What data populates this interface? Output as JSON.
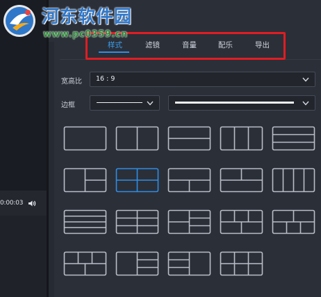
{
  "player": {
    "time": "0:00:03",
    "volume_icon": "speaker-icon"
  },
  "tabs": [
    {
      "label": "样式",
      "active": true
    },
    {
      "label": "滤镜",
      "active": false
    },
    {
      "label": "音量",
      "active": false
    },
    {
      "label": "配乐",
      "active": false
    },
    {
      "label": "导出",
      "active": false
    }
  ],
  "aspect": {
    "label": "宽高比",
    "value": "16 : 9"
  },
  "border": {
    "label": "边框"
  },
  "layouts": [
    {
      "name": "single",
      "selected": false
    },
    {
      "name": "split-2-vertical",
      "selected": false
    },
    {
      "name": "split-2-horizontal",
      "selected": false
    },
    {
      "name": "split-3-vertical",
      "selected": false
    },
    {
      "name": "split-3-horizontal",
      "selected": false
    },
    {
      "name": "left-plus-right-2",
      "selected": false
    },
    {
      "name": "grid-2x2",
      "selected": true
    },
    {
      "name": "top-plus-bottom-2",
      "selected": false
    },
    {
      "name": "top-2-plus-bottom",
      "selected": false
    },
    {
      "name": "split-4-vertical",
      "selected": false
    },
    {
      "name": "split-4-horizontal",
      "selected": false
    },
    {
      "name": "grid-2x3",
      "selected": false
    },
    {
      "name": "left-2-plus-right-3",
      "selected": false
    },
    {
      "name": "mixed-5",
      "selected": false
    },
    {
      "name": "top-2-plus-bottom-3",
      "selected": false
    },
    {
      "name": "top-3-plus-bottom-2",
      "selected": false
    },
    {
      "name": "left-plus-right-3",
      "selected": false
    },
    {
      "name": "left-3-plus-right",
      "selected": false
    },
    {
      "name": "grid-3x2-vertical",
      "selected": false
    }
  ],
  "watermark": {
    "title": "河东软件园",
    "url": "www.pc0359.cn"
  },
  "colors": {
    "accent": "#2e8ee6",
    "highlight": "#e11d22",
    "tile_stroke": "#b9bec7"
  }
}
